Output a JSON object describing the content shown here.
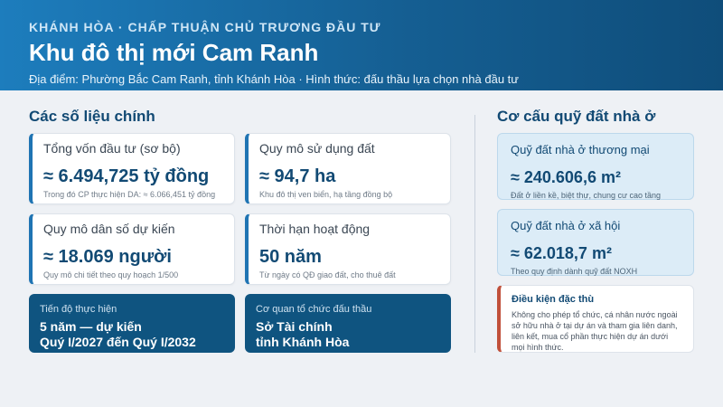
{
  "header": {
    "kicker": "KHÁNH HÒA · CHẤP THUẬN CHỦ TRƯƠNG ĐẦU TƯ",
    "title": "Khu đô thị mới Cam Ranh",
    "subtitle": "Địa điểm: Phường Bắc Cam Ranh, tỉnh Khánh Hòa · Hình thức: đấu thầu lựa chọn nhà đầu tư"
  },
  "left": {
    "title": "Các số liệu chính",
    "cards": [
      {
        "label": "Tổng vốn đầu tư (sơ bộ)",
        "value": "≈ 6.494,725 tỷ đồng",
        "note": "Trong đó CP thực hiện DA: ≈ 6.066,451 tỷ đồng"
      },
      {
        "label": "Quy mô sử dụng đất",
        "value": "≈ 94,7 ha",
        "note": "Khu đô thị ven biển, hạ tầng đồng bộ"
      },
      {
        "label": "Quy mô dân số dự kiến",
        "value": "≈ 18.069 người",
        "note": "Quy mô chi tiết theo quy hoạch 1/500"
      },
      {
        "label": "Thời hạn hoạt động",
        "value": "50 năm",
        "note": "Từ ngày có QĐ giao đất, cho thuê đất"
      }
    ],
    "progress": {
      "label": "Tiến độ thực hiện",
      "line1": "5 năm — dự kiến",
      "line2": "Quý I/2027 đến Quý I/2032"
    },
    "agency": {
      "label": "Cơ quan tổ chức đấu thầu",
      "line1": "Sở Tài chính",
      "line2": "tỉnh Khánh Hòa"
    }
  },
  "right": {
    "title": "Cơ cấu quỹ đất nhà ở",
    "commercial": {
      "label": "Quỹ đất nhà ở thương mại",
      "value": "≈ 240.606,6 m²",
      "note": "Đất ở liền kề, biệt thự, chung cư cao tầng"
    },
    "social": {
      "label": "Quỹ đất nhà ở xã hội",
      "value": "≈ 62.018,7 m²",
      "note": "Theo quy định dành quỹ đất NOXH"
    },
    "condition": {
      "label": "Điều kiện đặc thù",
      "text": "Không cho phép tổ chức, cá nhân nước ngoài sở hữu nhà ở tại dự án và tham gia liên danh, liên kết, mua cổ phần thực hiện dự án dưới mọi hình thức."
    }
  },
  "colors": {
    "header_start": "#1d7dbd",
    "header_end": "#0f4d7a",
    "accent": "#1f74b3",
    "dark_card": "#0f5480",
    "warning": "#c0503a"
  }
}
